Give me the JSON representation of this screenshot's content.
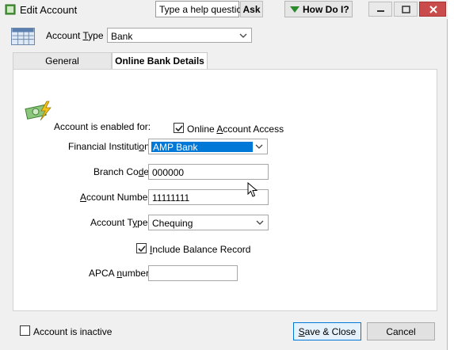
{
  "window": {
    "title": "Edit Account",
    "help_box": "Type a help question",
    "ask_label": "Ask",
    "how_do_i_label": "How Do I?"
  },
  "header": {
    "account_type_label_pre": "Account ",
    "account_type_label_u": "T",
    "account_type_label_post": "ype",
    "account_type_value": "Bank"
  },
  "tabs": [
    {
      "label": "General",
      "active": false
    },
    {
      "label": "Online Bank Details",
      "active": true
    }
  ],
  "form": {
    "enabled_for_label": "Account is enabled for:",
    "online_access_pre": "Online ",
    "online_access_u": "A",
    "online_access_post": "ccount Access",
    "online_access_checked": true,
    "fin_inst_label_pre": "Financial Instituti",
    "fin_inst_label_u": "o",
    "fin_inst_label_post": "n:",
    "fin_inst_value": "AMP Bank",
    "branch_label_pre": "Branch Co",
    "branch_label_u": "d",
    "branch_label_post": "e:",
    "branch_value": "000000",
    "acct_num_label_pre": "",
    "acct_num_label_u": "A",
    "acct_num_label_post": "ccount Number:",
    "acct_num_value": "11111111",
    "acct_type_label_pre": "Account T",
    "acct_type_label_u": "y",
    "acct_type_label_post": "pe:",
    "acct_type_value": "Chequing",
    "include_balance_pre": "",
    "include_balance_u": "I",
    "include_balance_post": "nclude Balance Record",
    "include_balance_checked": true,
    "apca_label_pre": "APCA ",
    "apca_label_u": "n",
    "apca_label_post": "umber:",
    "apca_value": ""
  },
  "footer": {
    "inactive_label": "Account is inactive",
    "inactive_checked": false,
    "save_pre": "",
    "save_u": "S",
    "save_post": "ave & Close",
    "cancel_label": "Cancel"
  },
  "colors": {
    "selection": "#0078d7",
    "close_button": "#c94b4b",
    "how_do_i_arrow": "#2c8a2c"
  }
}
